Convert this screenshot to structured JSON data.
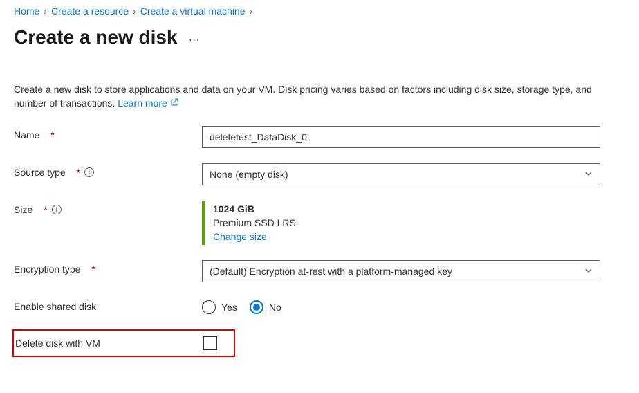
{
  "breadcrumb": {
    "items": [
      "Home",
      "Create a resource",
      "Create a virtual machine"
    ]
  },
  "page": {
    "title": "Create a new disk",
    "description": "Create a new disk to store applications and data on your VM. Disk pricing varies based on factors including disk size, storage type, and number of transactions.",
    "learn_more": "Learn more"
  },
  "form": {
    "name": {
      "label": "Name",
      "value": "deletetest_DataDisk_0"
    },
    "source_type": {
      "label": "Source type",
      "selected": "None (empty disk)"
    },
    "size": {
      "label": "Size",
      "value": "1024 GiB",
      "tier": "Premium SSD LRS",
      "change": "Change size"
    },
    "encryption": {
      "label": "Encryption type",
      "selected": "(Default) Encryption at-rest with a platform-managed key"
    },
    "shared": {
      "label": "Enable shared disk",
      "yes": "Yes",
      "no": "No"
    },
    "delete_with_vm": {
      "label": "Delete disk with VM"
    }
  }
}
